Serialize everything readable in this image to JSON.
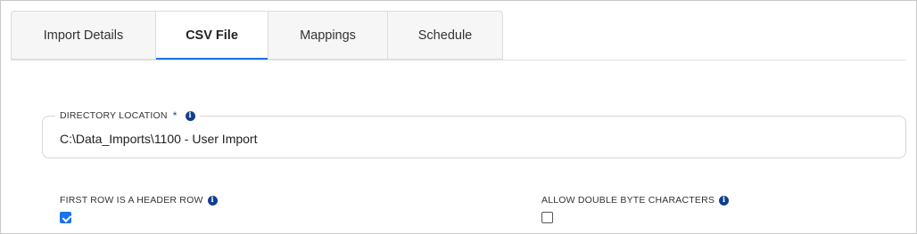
{
  "tabs": [
    {
      "label": "Import Details",
      "active": false
    },
    {
      "label": "CSV File",
      "active": true
    },
    {
      "label": "Mappings",
      "active": false
    },
    {
      "label": "Schedule",
      "active": false
    }
  ],
  "directory": {
    "label": "DIRECTORY LOCATION",
    "required_marker": "*",
    "value": "C:\\Data_Imports\\1100 - User Import"
  },
  "options": {
    "header_row": {
      "label": "FIRST ROW IS A HEADER ROW",
      "checked": true
    },
    "double_byte": {
      "label": "ALLOW DOUBLE BYTE CHARACTERS",
      "checked": false
    }
  },
  "icons": {
    "info": "info-icon"
  },
  "colors": {
    "accent": "#1a73e8",
    "info": "#123f8c"
  }
}
